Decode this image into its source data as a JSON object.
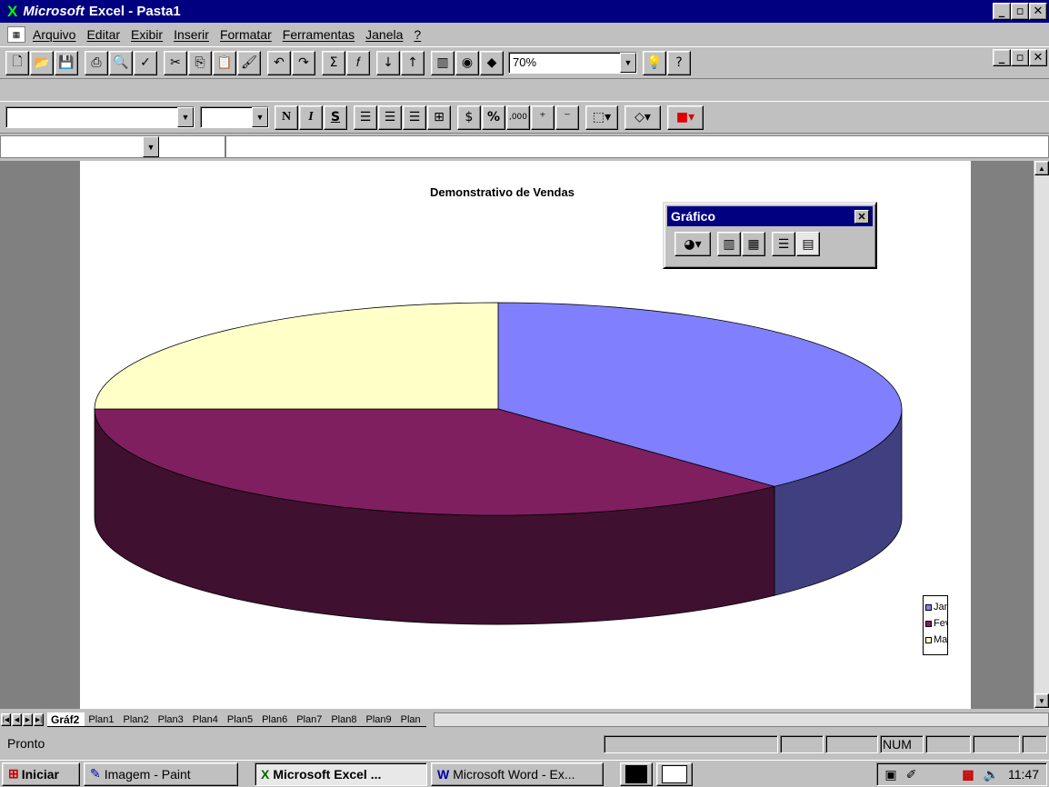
{
  "window": {
    "title_brand": "Microsoft",
    "title_rest": "Excel - Pasta1"
  },
  "menu": {
    "items": [
      "Arquivo",
      "Editar",
      "Exibir",
      "Inserir",
      "Formatar",
      "Ferramentas",
      "Janela",
      "?"
    ]
  },
  "toolbar": {
    "zoom": "70%"
  },
  "format_toolbar": {
    "bold": "N",
    "italic": "I",
    "underline": "S",
    "percent": "%",
    "thousands": ",000"
  },
  "chart_toolbar": {
    "title": "Gráfico"
  },
  "chart_data": {
    "type": "pie",
    "title": "Demonstrativo de Vendas",
    "categories": [
      "Jan",
      "Fev",
      "Mar"
    ],
    "values": [
      38,
      37,
      25
    ],
    "colors": [
      "#8080ff",
      "#7f1f5f",
      "#ffffc8"
    ],
    "style": "3d-pie"
  },
  "sheets": {
    "tabs": [
      "Gráf2",
      "Plan1",
      "Plan2",
      "Plan3",
      "Plan4",
      "Plan5",
      "Plan6",
      "Plan7",
      "Plan8",
      "Plan9",
      "Plan"
    ],
    "active": "Gráf2"
  },
  "status": {
    "text": "Pronto",
    "num": "NUM"
  },
  "taskbar": {
    "start": "Iniciar",
    "tasks": [
      "Imagem - Paint",
      "Microsoft Excel ...",
      "Microsoft Word - Ex..."
    ],
    "time": "11:47"
  }
}
